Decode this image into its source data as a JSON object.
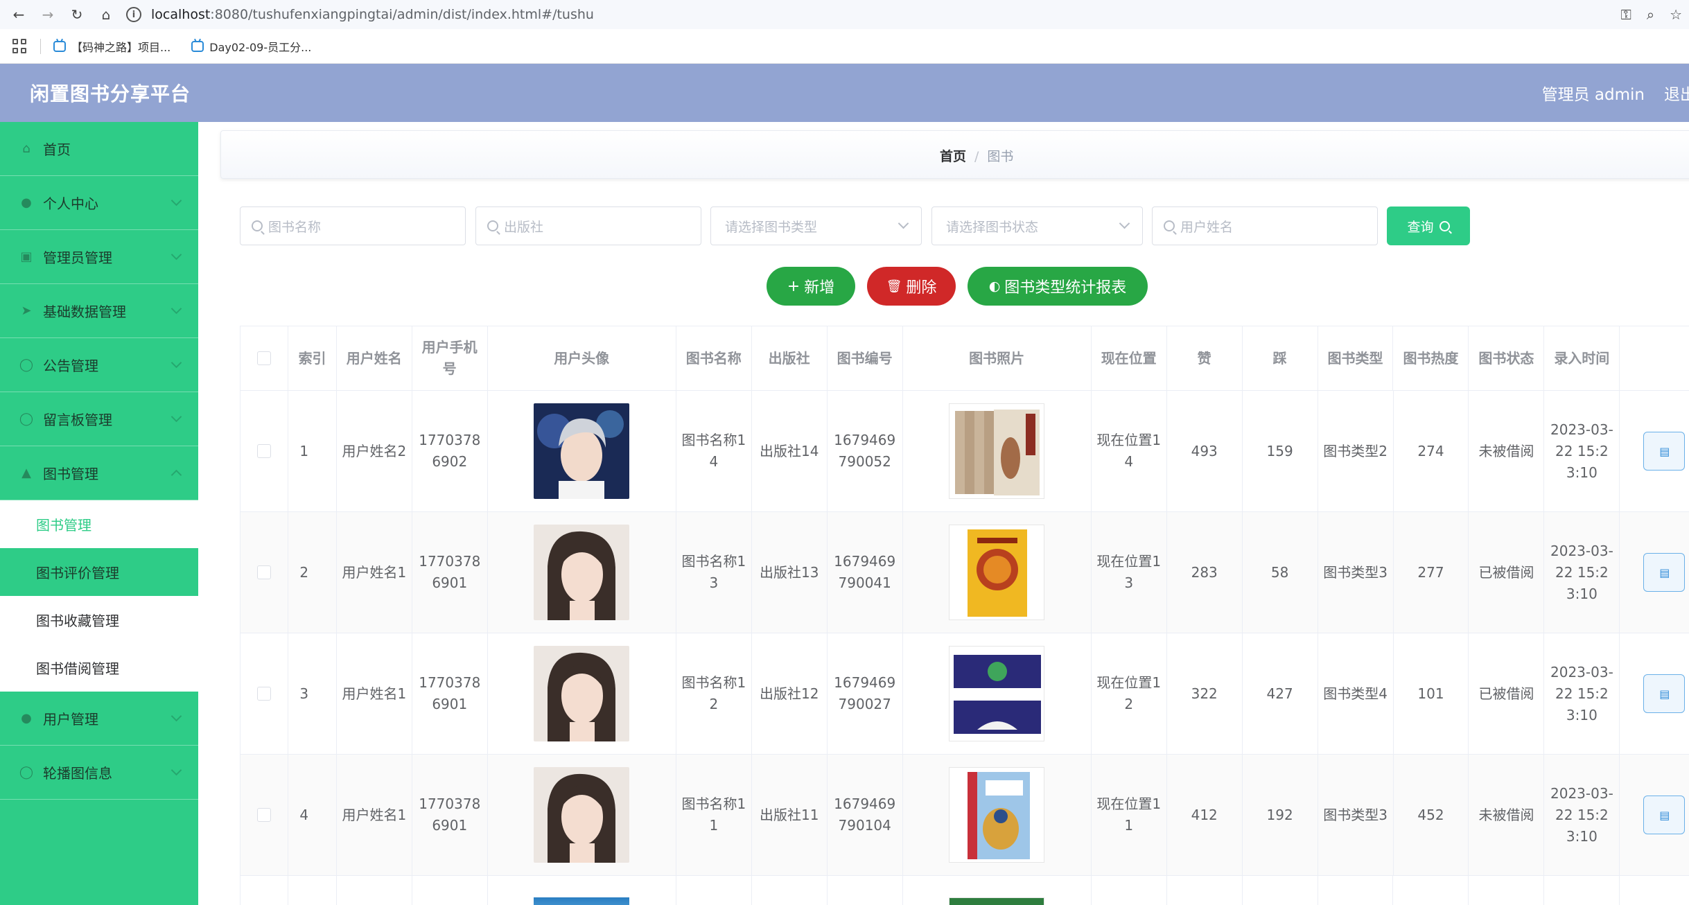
{
  "browser": {
    "url_host": "localhost",
    "url_rest": ":8080/tushufenxiangpingtai/admin/dist/index.html#/tushu",
    "bookmarks": [
      "【码神之路】项目...",
      "Day02-09-员工分..."
    ]
  },
  "header": {
    "title": "闲置图书分享平台",
    "user": "管理员 admin",
    "logout": "退出"
  },
  "sidebar": {
    "items": [
      {
        "label": "首页",
        "icon": "home-icon"
      },
      {
        "label": "个人中心",
        "icon": "user-icon"
      },
      {
        "label": "管理员管理",
        "icon": "admin-icon"
      },
      {
        "label": "基础数据管理",
        "icon": "send-icon"
      },
      {
        "label": "公告管理",
        "icon": "notice-icon"
      },
      {
        "label": "留言板管理",
        "icon": "message-icon"
      },
      {
        "label": "图书管理",
        "icon": "book-icon"
      }
    ],
    "sub_items": [
      "图书管理",
      "图书评价管理",
      "图书收藏管理",
      "图书借阅管理"
    ],
    "bottom_items": [
      {
        "label": "用户管理",
        "icon": "users-icon"
      },
      {
        "label": "轮播图信息",
        "icon": "carousel-icon"
      }
    ]
  },
  "breadcrumb": {
    "home": "首页",
    "separator": "/",
    "current": "图书"
  },
  "filters": {
    "book_name": "图书名称",
    "publisher": "出版社",
    "book_type": "请选择图书类型",
    "book_status": "请选择图书状态",
    "user_name": "用户姓名",
    "query": "查询"
  },
  "actions": {
    "add": "新增",
    "delete": "删除",
    "report": "图书类型统计报表"
  },
  "colors": {
    "header": "#92a4d2",
    "sidebar": "#2ecc87",
    "primary": "#2ecc87",
    "danger": "#d02828",
    "success": "#28a745"
  },
  "table": {
    "headers": [
      "索引",
      "用户姓名",
      "用户手机号",
      "用户头像",
      "图书名称",
      "出版社",
      "图书编号",
      "图书照片",
      "现在位置",
      "赞",
      "踩",
      "图书类型",
      "图书热度",
      "图书状态",
      "录入时间"
    ],
    "rows": [
      {
        "index": "1",
        "user": "用户姓名2",
        "phone": "17703786902",
        "book": "图书名称14",
        "publisher": "出版社14",
        "code": "1679469790052",
        "location": "现在位置14",
        "like": "493",
        "dislike": "159",
        "type": "图书类型2",
        "heat": "274",
        "status": "未被借阅",
        "time": "2023-03-22 15:23:10"
      },
      {
        "index": "2",
        "user": "用户姓名1",
        "phone": "17703786901",
        "book": "图书名称13",
        "publisher": "出版社13",
        "code": "1679469790041",
        "location": "现在位置13",
        "like": "283",
        "dislike": "58",
        "type": "图书类型3",
        "heat": "277",
        "status": "已被借阅",
        "time": "2023-03-22 15:23:10"
      },
      {
        "index": "3",
        "user": "用户姓名1",
        "phone": "17703786901",
        "book": "图书名称12",
        "publisher": "出版社12",
        "code": "1679469790027",
        "location": "现在位置12",
        "like": "322",
        "dislike": "427",
        "type": "图书类型4",
        "heat": "101",
        "status": "已被借阅",
        "time": "2023-03-22 15:23:10"
      },
      {
        "index": "4",
        "user": "用户姓名1",
        "phone": "17703786901",
        "book": "图书名称11",
        "publisher": "出版社11",
        "code": "1679469790104",
        "location": "现在位置11",
        "like": "412",
        "dislike": "192",
        "type": "图书类型3",
        "heat": "452",
        "status": "未被借阅",
        "time": "2023-03-22 15:23:10"
      }
    ]
  }
}
